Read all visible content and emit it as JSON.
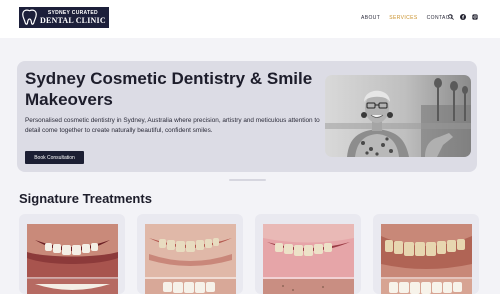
{
  "header": {
    "logo": {
      "line1": "SYDNEY CURATED",
      "line2": "DENTAL CLINIC"
    },
    "nav": [
      {
        "label": "ABOUT",
        "active": false
      },
      {
        "label": "SERVICES",
        "active": true
      },
      {
        "label": "CONTACT",
        "active": false
      }
    ],
    "icons": [
      "search-icon",
      "facebook-icon",
      "instagram-icon"
    ]
  },
  "hero": {
    "title": "Sydney Cosmetic Dentistry & Smile Makeovers",
    "description": "Personalised cosmetic dentistry in Sydney, Australia where precision, artistry and meticulous attention to detail come together to create naturally beautiful, confident smiles.",
    "cta_label": "Book Consultation"
  },
  "treatments": {
    "title": "Signature Treatments",
    "cards": [
      {
        "image": "smile-before-after-1"
      },
      {
        "image": "smile-before-after-2"
      },
      {
        "image": "smile-before-after-3"
      },
      {
        "image": "smile-before-after-4"
      }
    ]
  },
  "colors": {
    "brand_navy": "#1c1f3a",
    "accent_gold": "#c9902a",
    "hero_bg": "#dcdce5"
  }
}
